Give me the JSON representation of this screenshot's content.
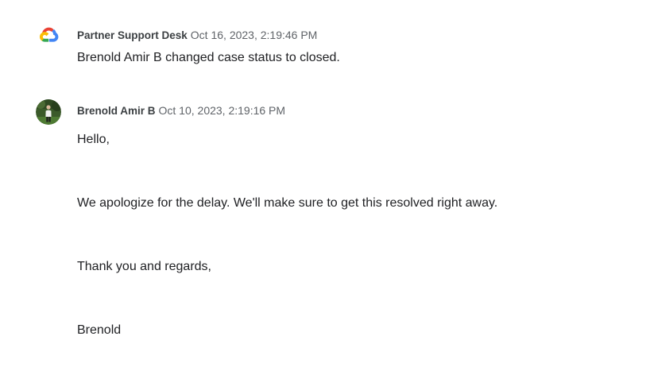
{
  "timeline": {
    "entries": [
      {
        "author": "Partner Support Desk",
        "timestamp": "Oct 16, 2023, 2:19:46 PM",
        "avatar_icon": "google-cloud-logo-icon",
        "message": "Brenold Amir B changed case status to closed."
      },
      {
        "author": "Brenold Amir B",
        "timestamp": "Oct 10, 2023, 2:19:16 PM",
        "avatar_icon": "user-photo-avatar",
        "paragraphs": [
          "Hello,",
          "We apologize for the delay. We'll make sure to get this resolved right away.",
          "Thank you and regards,",
          "Brenold"
        ]
      }
    ]
  },
  "colors": {
    "cloud_red": "#ea4335",
    "cloud_blue": "#4285f4",
    "cloud_yellow": "#fbbc04",
    "cloud_green": "#34a853",
    "author_text": "#3c4043",
    "timestamp_text": "#5f6368",
    "body_text": "#202124"
  }
}
